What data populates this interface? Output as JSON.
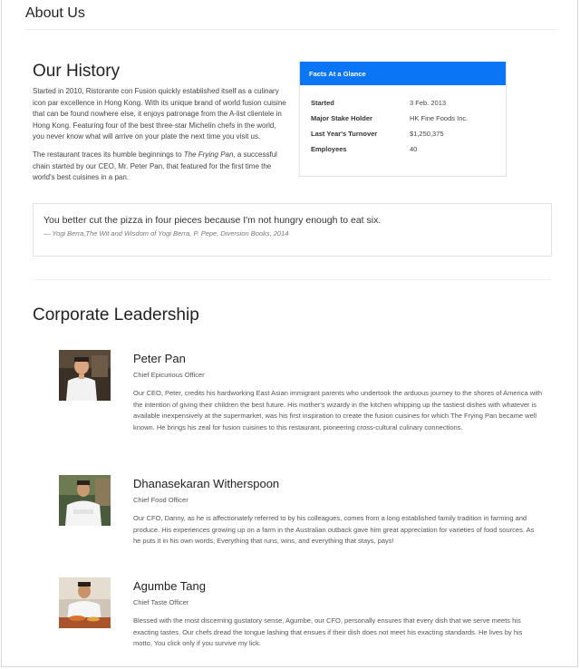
{
  "page": {
    "title": "About Us"
  },
  "history": {
    "heading": "Our History",
    "p1": "Started in 2010, Ristorante con Fusion quickly established itself as a culinary icon par excellence in Hong Kong. With its unique brand of world fusion cuisine that can be found nowhere else, it enjoys patronage from the A-list clientele in Hong Kong. Featuring four of the best three-star Michelin chefs in the world, you never know what will arrive on your plate the next time you visit us.",
    "p2_before": "The restaurant traces its humble beginnings to ",
    "p2_em": "The Frying Pan",
    "p2_after": ", a successful chain started by our CEO, Mr. Peter Pan, that featured for the first time the world's best cuisines in a pan."
  },
  "facts": {
    "header": "Facts At a Glance",
    "rows": [
      {
        "label": "Started",
        "value": "3 Feb. 2013"
      },
      {
        "label": "Major Stake Holder",
        "value": "HK Fine Foods Inc."
      },
      {
        "label": "Last Year's Turnover",
        "value": "$1,250,375"
      },
      {
        "label": "Employees",
        "value": "40"
      }
    ]
  },
  "quote": {
    "text": "You better cut the pizza in four pieces because I'm not hungry enough to eat six.",
    "cite": "— Yogi Berra,The Wit and Wisdom of Yogi Berra, P. Pepe, Diversion Books, 2014"
  },
  "leadership": {
    "heading": "Corporate Leadership",
    "leaders": [
      {
        "name": "Peter Pan",
        "role": "Chief Epicurious Officer",
        "bio": "Our CEO, Peter, credits his hardworking East Asian immigrant parents who undertook the arduous journey to the shores of America with the intention of giving their children the best future. His mother's wizardy in the kitchen whipping up the tastiest dishes with whatever is available inexpensively at the supermarket, was his first inspiration to create the fusion cuisines for which The Frying Pan became well known. He brings his zeal for fusion cuisines to this restaurant, pioneering cross-cultural culinary connections."
      },
      {
        "name": "Dhanasekaran Witherspoon",
        "role": "Chief Food Officer",
        "bio": "Our CFO, Danny, as he is affectionately referred to by his colleagues, comes from a long established family tradition in farming and produce. His experiences growing up on a farm in the Australian outback gave him great appreciation for varieties of food sources. As he puts it in his own words, Everything that runs, wins, and everything that stays, pays!"
      },
      {
        "name": "Agumbe Tang",
        "role": "Chief Taste Officer",
        "bio": "Blessed with the most discerning gustatory sense, Agumbe, our CFO, personally ensures that every dish that we serve meets his exacting tastes. Our chefs dread the tongue lashing that ensues if their dish does not meet his exacting standards. He lives by his motto, You click only if you survive my lick."
      }
    ]
  },
  "colors": {
    "accent": "#0a76f5"
  }
}
